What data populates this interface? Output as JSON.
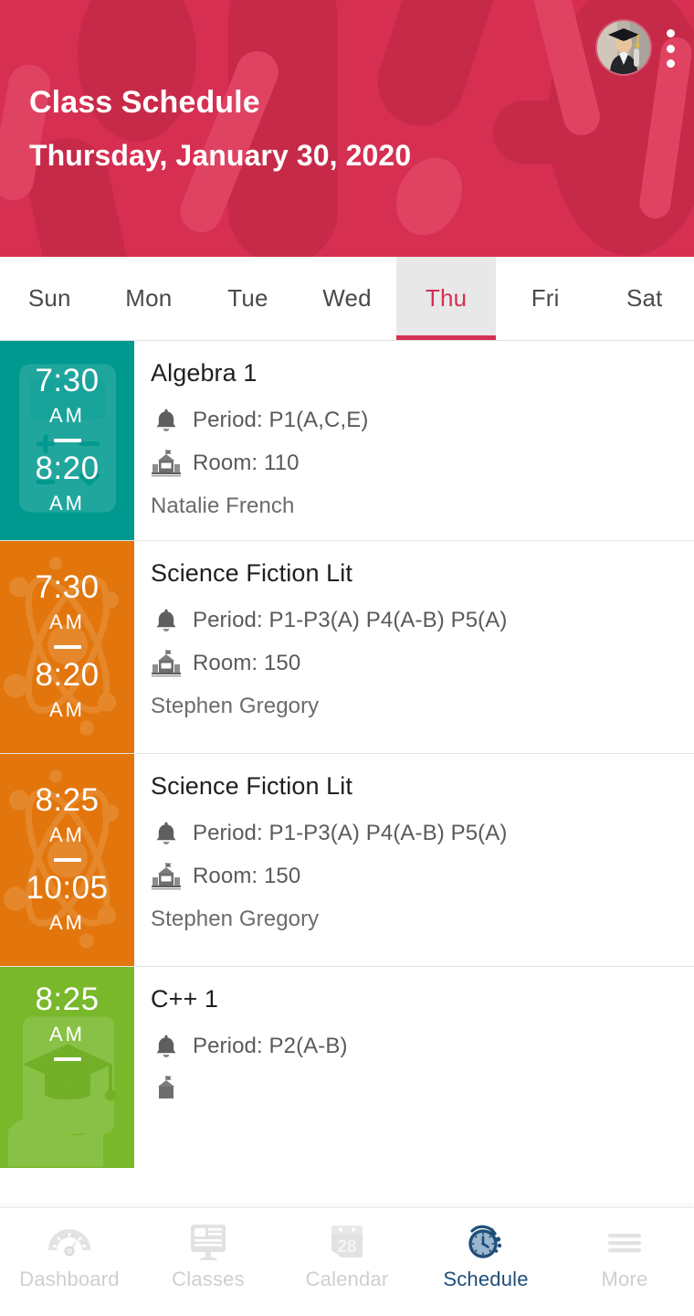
{
  "header": {
    "title": "Class Schedule",
    "subtitle": "Thursday, January 30, 2020",
    "background_color": "#d62f52",
    "avatar_name": "user-avatar-graduate-photo",
    "overflow_menu_name": "overflow-menu-icon"
  },
  "day_tabs": {
    "items": [
      {
        "label": "Sun",
        "active": false
      },
      {
        "label": "Mon",
        "active": false
      },
      {
        "label": "Tue",
        "active": false
      },
      {
        "label": "Wed",
        "active": false
      },
      {
        "label": "Thu",
        "active": true
      },
      {
        "label": "Fri",
        "active": false
      },
      {
        "label": "Sat",
        "active": false
      }
    ],
    "active_color": "#d62f52",
    "active_background": "#e8e8e8"
  },
  "schedule": {
    "period_label_prefix": "Period:",
    "room_label_prefix": "Room:",
    "classes": [
      {
        "start_time": "7:30",
        "start_meridiem": "AM",
        "end_time": "8:20",
        "end_meridiem": "AM",
        "title": "Algebra 1",
        "period": "Period: P1(A,C,E)",
        "room": "Room: 110",
        "teacher": "Natalie French",
        "color": "#00998f",
        "watermark": "calculator-icon"
      },
      {
        "start_time": "7:30",
        "start_meridiem": "AM",
        "end_time": "8:20",
        "end_meridiem": "AM",
        "title": "Science Fiction Lit",
        "period": "Period: P1-P3(A) P4(A-B) P5(A)",
        "room": "Room: 150",
        "teacher": "Stephen Gregory",
        "color": "#e2760c",
        "watermark": "atom-icon"
      },
      {
        "start_time": "8:25",
        "start_meridiem": "AM",
        "end_time": "10:05",
        "end_meridiem": "AM",
        "title": "Science Fiction Lit",
        "period": "Period: P1-P3(A) P4(A-B) P5(A)",
        "room": "Room: 150",
        "teacher": "Stephen Gregory",
        "color": "#e2760c",
        "watermark": "atom-icon"
      },
      {
        "start_time": "8:25",
        "start_meridiem": "AM",
        "end_time": "",
        "end_meridiem": "",
        "title": "C++ 1",
        "period": "Period: P2(A-B)",
        "room": "",
        "teacher": "",
        "color": "#78b82a",
        "watermark": "graduation-cap-icon"
      }
    ]
  },
  "bottom_nav": {
    "active_color": "#1f4e79",
    "inactive_color": "#cfcfcf",
    "items": [
      {
        "label": "Dashboard",
        "icon": "gauge-icon",
        "active": false
      },
      {
        "label": "Classes",
        "icon": "monitor-icon",
        "active": false
      },
      {
        "label": "Calendar",
        "icon": "calendar-28-icon",
        "active": false
      },
      {
        "label": "Schedule",
        "icon": "clock-refresh-icon",
        "active": true
      },
      {
        "label": "More",
        "icon": "hamburger-icon",
        "active": false
      }
    ]
  }
}
